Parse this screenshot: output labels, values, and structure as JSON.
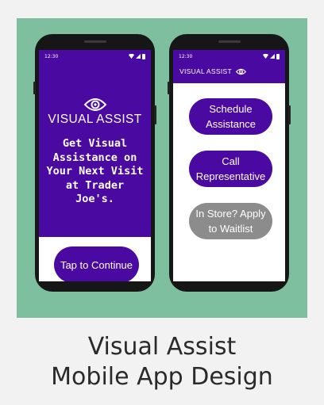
{
  "status_bar": {
    "time": "12:30",
    "icons": [
      "wifi-icon",
      "signal-icon",
      "battery-icon"
    ]
  },
  "screen_welcome": {
    "brand_icon": "eye-icon",
    "title": "VISUAL ASSIST",
    "description": "Get Visual Assistance on Your Next Visit at Trader Joe's.",
    "continue_button": "Tap to Continue"
  },
  "screen_menu": {
    "app_bar_title": "VISUAL ASSIST",
    "app_bar_icon": "eye-icon",
    "buttons": [
      {
        "label": "Schedule Assistance",
        "style": "primary"
      },
      {
        "label": "Call Representative",
        "style": "primary"
      },
      {
        "label": "In Store? Apply to Waitlist",
        "style": "disabled"
      }
    ]
  },
  "caption": {
    "line1": "Visual Assist",
    "line2": "Mobile App Design"
  },
  "colors": {
    "background": "#7dbf9e",
    "primary": "#4a0aa2",
    "disabled": "#8c8c8c",
    "page": "#f2f2f2"
  }
}
